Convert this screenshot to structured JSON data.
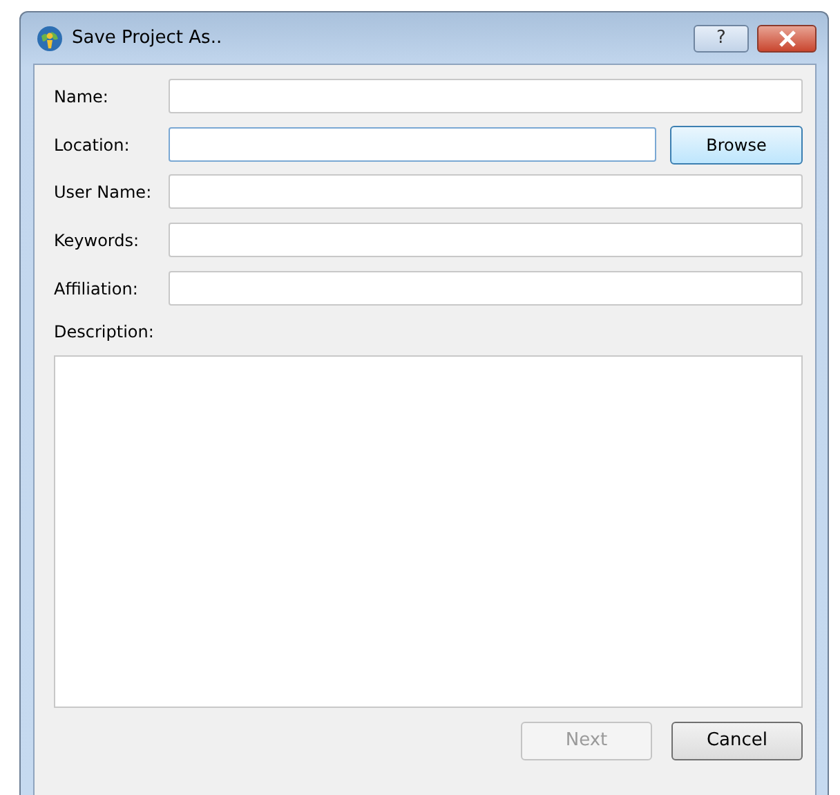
{
  "window": {
    "title": "Save Project As..",
    "help_button": "?"
  },
  "fields": [
    {
      "label": "Name:",
      "focused": false
    },
    {
      "label": "Location:",
      "focused": true,
      "button": "Browse"
    },
    {
      "label": "User Name:",
      "focused": false
    },
    {
      "label": "Keywords:",
      "focused": false
    },
    {
      "label": "Affiliation:",
      "focused": false
    }
  ],
  "description": {
    "label": "Description:"
  },
  "buttons": [
    {
      "label": "Next",
      "disabled": true
    },
    {
      "label": "Cancel",
      "disabled": false
    }
  ]
}
